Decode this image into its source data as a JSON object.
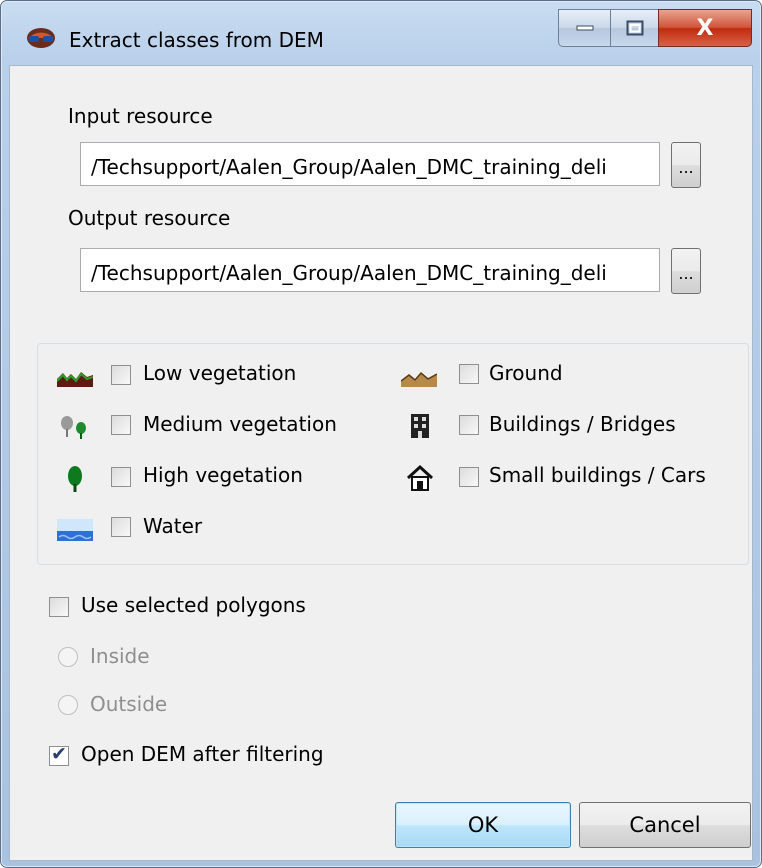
{
  "window": {
    "title": "Extract classes from DEM",
    "close_glyph": "X"
  },
  "input": {
    "label": "Input resource",
    "value": "/Techsupport/Aalen_Group/Aalen_DMC_training_deli",
    "browse_label": "..."
  },
  "output": {
    "label": "Output resource",
    "value": "/Techsupport/Aalen_Group/Aalen_DMC_training_deli",
    "browse_label": "..."
  },
  "classes": {
    "low_vegetation": {
      "label": "Low vegetation",
      "checked": false,
      "icon": "low-vegetation-icon"
    },
    "medium_vegetation": {
      "label": "Medium vegetation",
      "checked": false,
      "icon": "medium-vegetation-icon"
    },
    "high_vegetation": {
      "label": "High vegetation",
      "checked": false,
      "icon": "high-vegetation-icon"
    },
    "water": {
      "label": "Water",
      "checked": false,
      "icon": "water-icon"
    },
    "ground": {
      "label": "Ground",
      "checked": false,
      "icon": "ground-icon"
    },
    "buildings": {
      "label": "Buildings / Bridges",
      "checked": false,
      "icon": "building-icon"
    },
    "small_buildings": {
      "label": "Small buildings / Cars",
      "checked": false,
      "icon": "house-icon"
    }
  },
  "options": {
    "use_selected_polygons": {
      "label": "Use selected polygons",
      "checked": false
    },
    "inside": {
      "label": "Inside",
      "enabled": false
    },
    "outside": {
      "label": "Outside",
      "enabled": false
    },
    "open_dem": {
      "label": "Open DEM after filtering",
      "checked": true
    }
  },
  "buttons": {
    "ok": "OK",
    "cancel": "Cancel"
  },
  "colors": {
    "title_bar": "#b9d0ea",
    "close_button": "#c22b0e",
    "client_bg": "#f0f0f0",
    "default_button": "#bee6fd",
    "disabled_text": "#8f8f8f"
  }
}
